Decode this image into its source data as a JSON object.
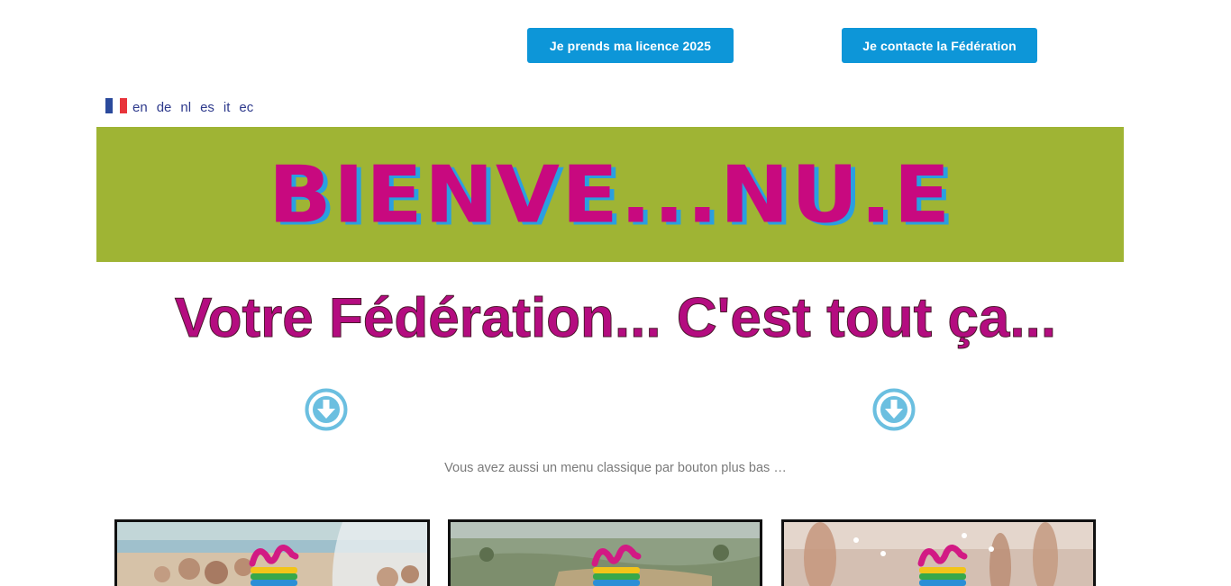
{
  "header": {
    "licence_button": "Je prends ma licence 2025",
    "contact_button": "Je contacte la Fédération"
  },
  "language_switcher": {
    "current_flag": "flag-france-icon",
    "items": [
      "en",
      "de",
      "nl",
      "es",
      "it",
      "ec"
    ]
  },
  "banner": {
    "text": "BIENVE...NU.E",
    "colors": {
      "background": "#9fb434",
      "text": "#c8097f",
      "shadow": "#2a9fe0"
    }
  },
  "headline": "Votre Fédération... C'est tout ça...",
  "scroll_icons": [
    "arrow-down-circle-icon",
    "arrow-down-circle-icon"
  ],
  "subnote": "Vous avez aussi un menu classique par bouton plus bas …",
  "cards": [
    {
      "icon": "ffn-logo-icon",
      "theme": "beach-photo"
    },
    {
      "icon": "ffn-logo-icon",
      "theme": "countryside-photo"
    },
    {
      "icon": "ffn-logo-icon",
      "theme": "seaside-photo"
    }
  ],
  "accent_colors": {
    "button": "#0d96d8",
    "arrow": "#6bbfe0"
  }
}
